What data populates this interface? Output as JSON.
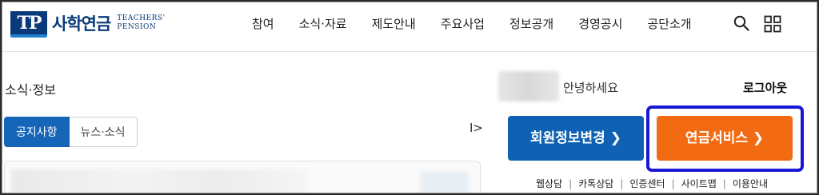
{
  "header": {
    "logo_mark": "TP",
    "logo_ko": "사학연금",
    "logo_en_line1": "TEACHERS'",
    "logo_en_line2": "PENSION",
    "nav": [
      "참여",
      "소식·자료",
      "제도안내",
      "주요사업",
      "정보공개",
      "경영공시",
      "공단소개"
    ],
    "icons": [
      "search-icon",
      "grid-menu-icon"
    ]
  },
  "news": {
    "title": "소식·정보",
    "tabs": [
      {
        "label": "공지사항",
        "active": true
      },
      {
        "label": "뉴스·소식",
        "active": false
      }
    ],
    "rolling_control": "I>"
  },
  "user": {
    "greeting": "안녕하세요",
    "logout": "로그아웃",
    "member_button": "회원정보변경 ❯",
    "pension_button": "연금서비스 ❯"
  },
  "footer_links": [
    "웹상담",
    "카톡상담",
    "인증센터",
    "사이트맵",
    "이용안내"
  ],
  "colors": {
    "brand_navy": "#0a3a7a",
    "primary_blue": "#0f62b3",
    "tab_active": "#1565b8",
    "accent_orange": "#f26b12",
    "highlight_box": "#1a17d6"
  }
}
